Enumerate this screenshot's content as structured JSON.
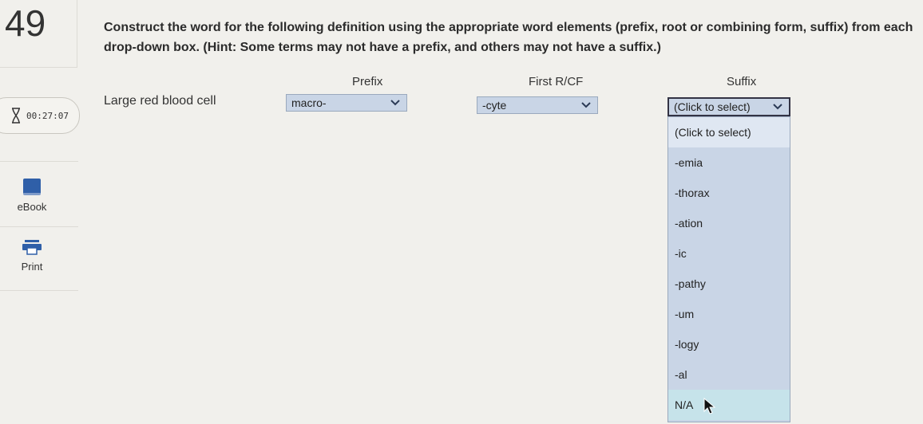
{
  "question": {
    "number": "49"
  },
  "timer": {
    "value": "00:27:07"
  },
  "sidebar": {
    "ebook_label": "eBook",
    "print_label": "Print"
  },
  "instructions": "Construct the word for the following definition using the appropriate word elements (prefix, root or combining form, suffix) from each drop-down box. (Hint: Some terms may not have a prefix, and others may not have a suffix.)",
  "columns": {
    "prefix": "Prefix",
    "root": "First R/CF",
    "suffix": "Suffix"
  },
  "definition": "Large red blood cell",
  "selects": {
    "prefix_value": "macro-",
    "root_value": "-cyte",
    "suffix_value": "(Click to select)"
  },
  "suffix_options": [
    "(Click to select)",
    "-emia",
    "-thorax",
    "-ation",
    "-ic",
    "-pathy",
    "-um",
    "-logy",
    "-al",
    "N/A"
  ],
  "colors": {
    "select_bg": "#c9d5e6",
    "hover_bg": "#c6e3ea",
    "accent": "#2f5fa8"
  }
}
